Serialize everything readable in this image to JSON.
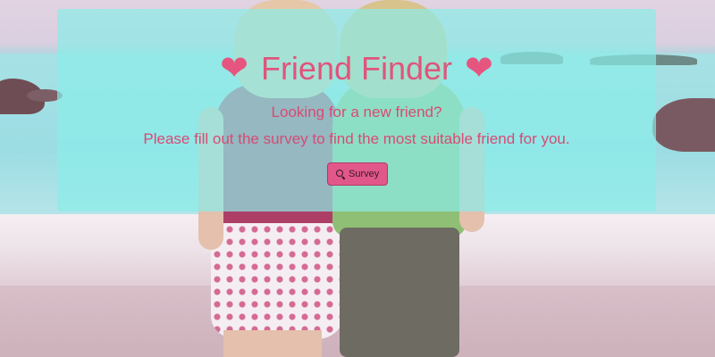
{
  "header": {
    "heart_left": "❤",
    "title": "Friend Finder",
    "heart_right": "❤",
    "subtitle": "Looking for a new friend?",
    "description": "Please fill out the survey to find the most suitable friend for you."
  },
  "actions": {
    "survey_label": "Survey",
    "survey_icon": "search-icon"
  },
  "colors": {
    "accent": "#e5557f",
    "panel": "#8aece8",
    "button": "#e1578a"
  }
}
